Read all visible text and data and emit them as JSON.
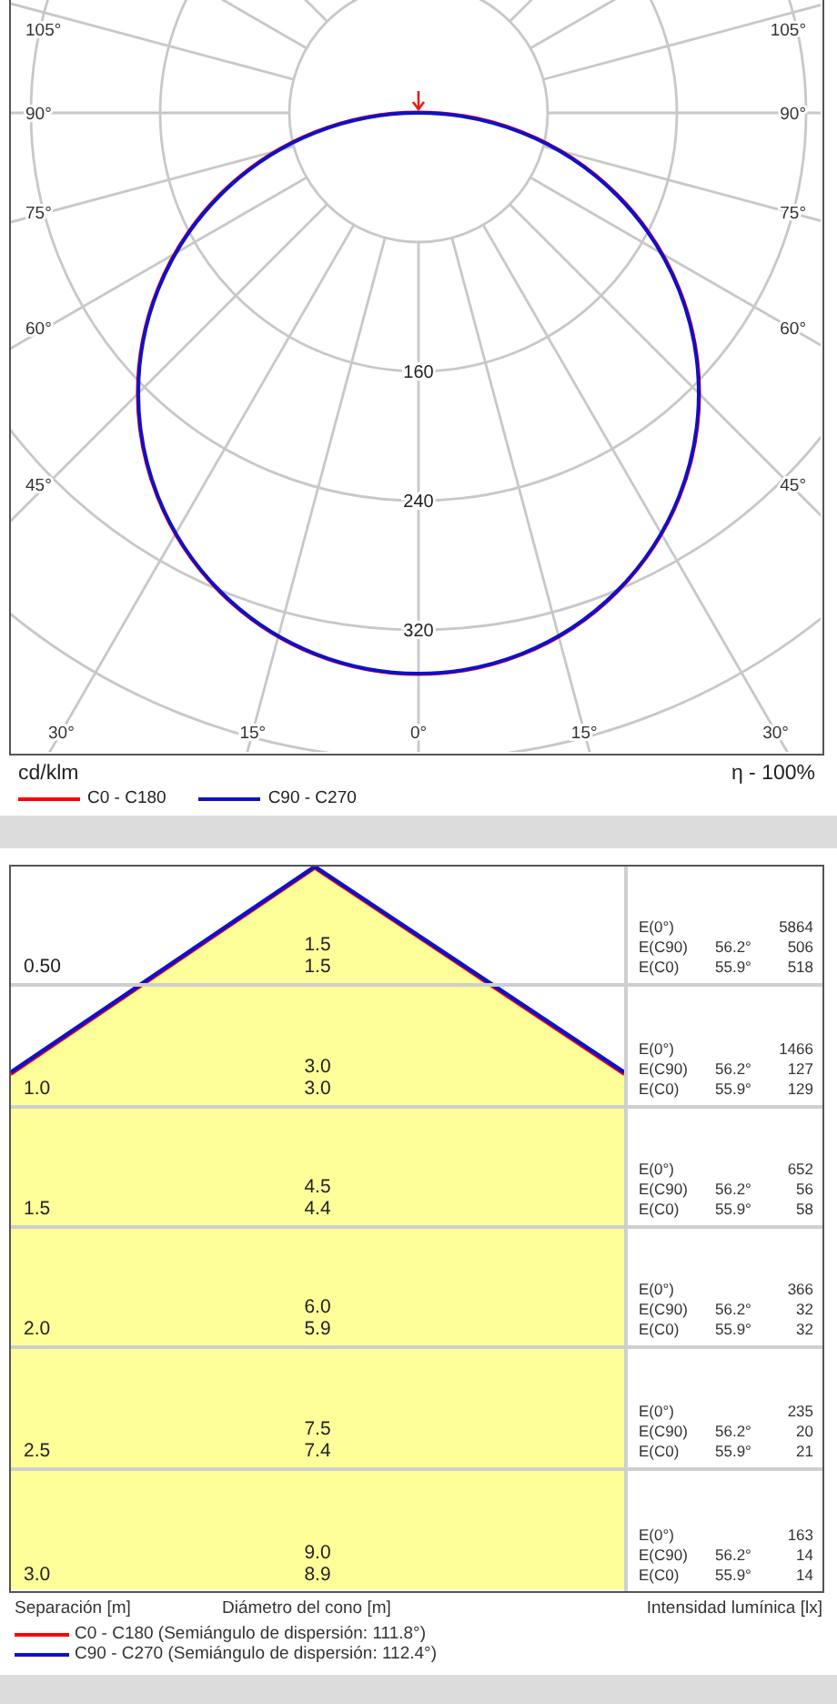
{
  "polar_chart": {
    "left_angle_labels": [
      "105°",
      "90°",
      "75°",
      "60°",
      "45°"
    ],
    "right_angle_labels": [
      "105°",
      "90°",
      "75°",
      "60°",
      "45°"
    ],
    "bottom_angle_labels": [
      "30°",
      "15°",
      "0°",
      "15°",
      "30°"
    ],
    "ring_labels": [
      "160",
      "240",
      "320"
    ],
    "unit": "cd/klm",
    "efficiency": "η - 100%",
    "legend": [
      {
        "label": "C0 - C180",
        "color": "#ff0000"
      },
      {
        "label": "C90 - C270",
        "color": "#1010c8"
      }
    ]
  },
  "cone_table": {
    "rows": [
      {
        "separation": "0.50",
        "diameters": [
          "1.5",
          "1.5"
        ],
        "illuminance": [
          {
            "label": "E(0°)",
            "value": "5864"
          },
          {
            "label": "E(C90)",
            "angle": "56.2°",
            "value": "506"
          },
          {
            "label": "E(C0)",
            "angle": "55.9°",
            "value": "518"
          }
        ]
      },
      {
        "separation": "1.0",
        "diameters": [
          "3.0",
          "3.0"
        ],
        "illuminance": [
          {
            "label": "E(0°)",
            "value": "1466"
          },
          {
            "label": "E(C90)",
            "angle": "56.2°",
            "value": "127"
          },
          {
            "label": "E(C0)",
            "angle": "55.9°",
            "value": "129"
          }
        ]
      },
      {
        "separation": "1.5",
        "diameters": [
          "4.5",
          "4.4"
        ],
        "illuminance": [
          {
            "label": "E(0°)",
            "value": "652"
          },
          {
            "label": "E(C90)",
            "angle": "56.2°",
            "value": "56"
          },
          {
            "label": "E(C0)",
            "angle": "55.9°",
            "value": "58"
          }
        ]
      },
      {
        "separation": "2.0",
        "diameters": [
          "6.0",
          "5.9"
        ],
        "illuminance": [
          {
            "label": "E(0°)",
            "value": "366"
          },
          {
            "label": "E(C90)",
            "angle": "56.2°",
            "value": "32"
          },
          {
            "label": "E(C0)",
            "angle": "55.9°",
            "value": "32"
          }
        ]
      },
      {
        "separation": "2.5",
        "diameters": [
          "7.5",
          "7.4"
        ],
        "illuminance": [
          {
            "label": "E(0°)",
            "value": "235"
          },
          {
            "label": "E(C90)",
            "angle": "56.2°",
            "value": "20"
          },
          {
            "label": "E(C0)",
            "angle": "55.9°",
            "value": "21"
          }
        ]
      },
      {
        "separation": "3.0",
        "diameters": [
          "9.0",
          "8.9"
        ],
        "illuminance": [
          {
            "label": "E(0°)",
            "value": "163"
          },
          {
            "label": "E(C90)",
            "angle": "56.2°",
            "value": "14"
          },
          {
            "label": "E(C0)",
            "angle": "55.9°",
            "value": "14"
          }
        ]
      }
    ],
    "column_labels": [
      "Separación [m]",
      "Diámetro del cono [m]",
      "Intensidad lumínica [lx]"
    ],
    "legend": [
      {
        "label": "C0 - C180 (Semiángulo de dispersión: 111.8°)",
        "color": "#ff0000"
      },
      {
        "label": "C90 - C270 (Semiángulo de dispersión: 112.4°)",
        "color": "#1010c8"
      }
    ]
  }
}
